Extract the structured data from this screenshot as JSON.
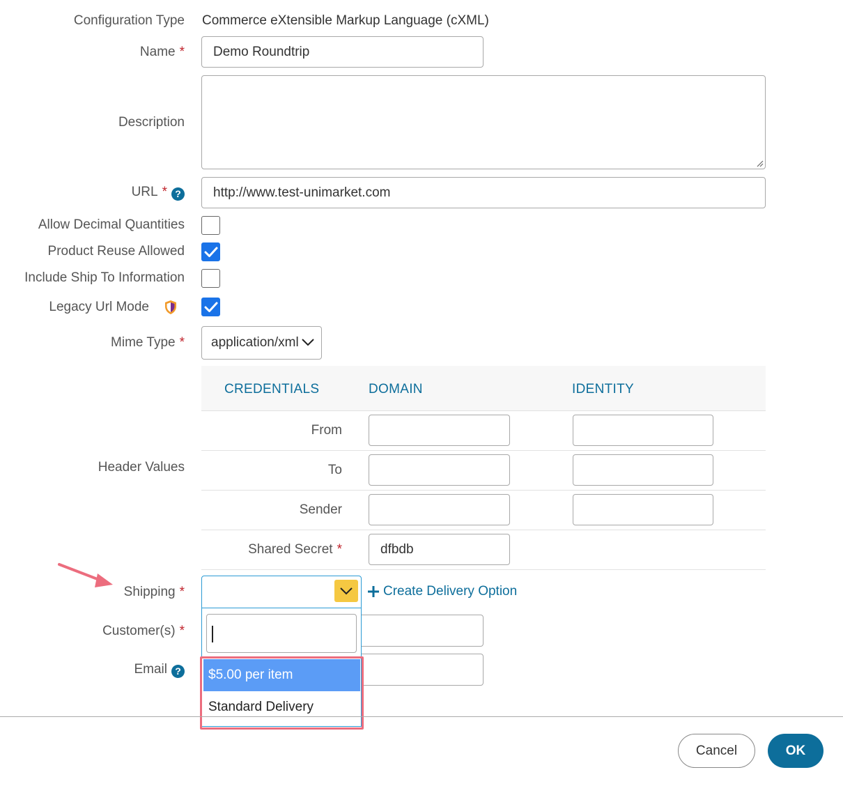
{
  "form": {
    "configuration_type": {
      "label": "Configuration Type",
      "value": "Commerce eXtensible Markup Language (cXML)"
    },
    "name": {
      "label": "Name",
      "value": "Demo Roundtrip"
    },
    "description": {
      "label": "Description",
      "value": ""
    },
    "url": {
      "label": "URL",
      "value": "http://www.test-unimarket.com"
    },
    "allow_decimal": {
      "label": "Allow Decimal Quantities",
      "checked": false
    },
    "product_reuse": {
      "label": "Product Reuse Allowed",
      "checked": true
    },
    "include_ship_to": {
      "label": "Include Ship To Information",
      "checked": false
    },
    "legacy_url": {
      "label": "Legacy Url Mode",
      "checked": true
    },
    "mime_type": {
      "label": "Mime Type",
      "value": "application/xml"
    },
    "header_values": {
      "label": "Header Values",
      "columns": [
        "CREDENTIALS",
        "DOMAIN",
        "IDENTITY"
      ],
      "rows": [
        {
          "label": "From",
          "domain": "",
          "identity": ""
        },
        {
          "label": "To",
          "domain": "",
          "identity": ""
        },
        {
          "label": "Sender",
          "domain": "",
          "identity": ""
        }
      ],
      "shared_secret": {
        "label": "Shared Secret",
        "value": "dfbdb"
      }
    },
    "shipping": {
      "label": "Shipping",
      "value": "",
      "create_link": "Create Delivery Option",
      "search_value": "",
      "options": [
        "$5.00 per item",
        "Standard Delivery"
      ],
      "highlighted_option": "$5.00 per item"
    },
    "customers": {
      "label": "Customer(s)",
      "value": ""
    },
    "email": {
      "label": "Email",
      "value": ""
    },
    "required_mark": "*",
    "help_glyph": "?"
  },
  "footer": {
    "cancel_label": "Cancel",
    "ok_label": "OK"
  },
  "colors": {
    "accent": "#0d6e9b",
    "required": "#c0232c",
    "checkbox": "#1a73e8",
    "toggle": "#f5c842",
    "highlight": "#ec6d7e",
    "option_selected": "#5b9cf6"
  }
}
